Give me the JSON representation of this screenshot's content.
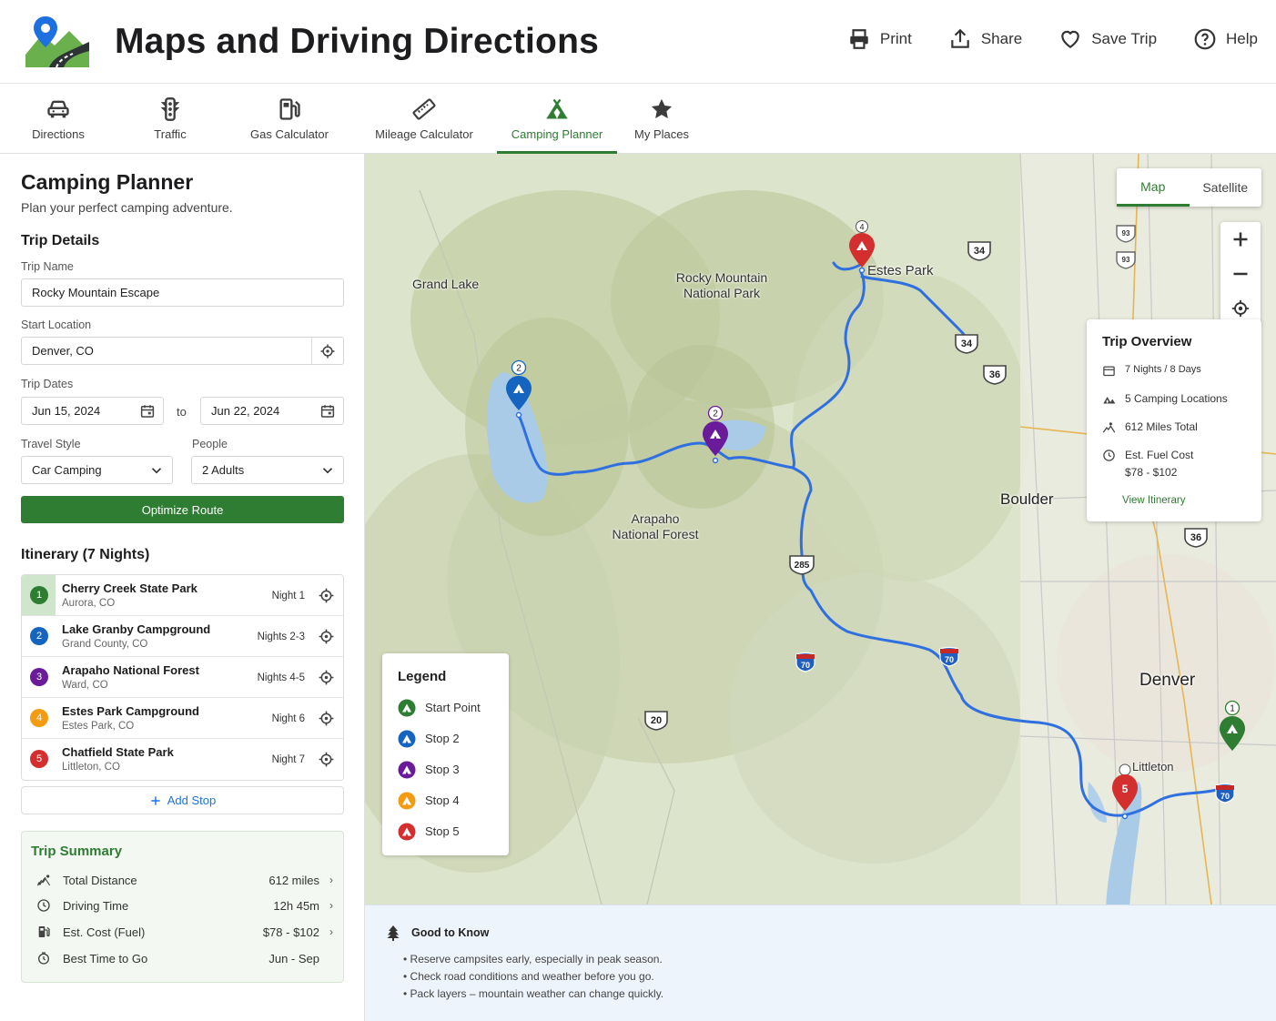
{
  "app": {
    "title": "Maps and Driving Directions"
  },
  "header": {
    "print": "Print",
    "share": "Share",
    "save": "Save Trip",
    "help": "Help"
  },
  "tabs": [
    {
      "label": "Directions",
      "icon": "car-icon"
    },
    {
      "label": "Traffic",
      "icon": "traffic-light-icon"
    },
    {
      "label": "Gas Calculator",
      "icon": "gas-pump-icon"
    },
    {
      "label": "Mileage Calculator",
      "icon": "ruler-icon"
    },
    {
      "label": "Camping Planner",
      "icon": "tent-icon",
      "active": true
    },
    {
      "label": "My Places",
      "icon": "star-icon"
    }
  ],
  "planner": {
    "title": "Camping Planner",
    "subtitle": "Plan your perfect camping adventure.",
    "trip_details_title": "Trip Details",
    "trip_name_label": "Trip Name",
    "trip_name": "Rocky Mountain Escape",
    "start_location_label": "Start Location",
    "start_location": "Denver, CO",
    "trip_dates_label": "Trip Dates",
    "date_start": "Jun 15, 2024",
    "date_to": "to",
    "date_end": "Jun 22, 2024",
    "travel_style_label": "Travel Style",
    "travel_style": "Car Camping",
    "people_label": "People",
    "people": "2 Adults",
    "optimize": "Optimize Route"
  },
  "itinerary": {
    "title": "Itinerary (7 Nights)",
    "add_stop": "Add Stop",
    "items": [
      {
        "num": "1",
        "name": "Cherry Creek State Park",
        "location": "Aurora, CO",
        "nights": "Night 1",
        "color": "#2e7d32"
      },
      {
        "num": "2",
        "name": "Lake Granby Campground",
        "location": "Grand County, CO",
        "nights": "Nights 2-3",
        "color": "#1565c0"
      },
      {
        "num": "3",
        "name": "Arapaho National Forest",
        "location": "Ward, CO",
        "nights": "Nights 4-5",
        "color": "#6a1b9a"
      },
      {
        "num": "4",
        "name": "Estes Park Campground",
        "location": "Estes Park, CO",
        "nights": "Night 6",
        "color": "#f39c12"
      },
      {
        "num": "5",
        "name": "Chatfield State Park",
        "location": "Littleton, CO",
        "nights": "Night 7",
        "color": "#d32f2f"
      }
    ]
  },
  "summary": {
    "title": "Trip Summary",
    "rows": [
      {
        "label": "Total Distance",
        "value": "612 miles",
        "icon": "route-icon"
      },
      {
        "label": "Driving Time",
        "value": "12h 45m",
        "icon": "clock-icon"
      },
      {
        "label": "Est. Cost (Fuel)",
        "value": "$78 - $102",
        "icon": "fuel-icon"
      },
      {
        "label": "Best Time to Go",
        "value": "Jun - Sep",
        "icon": "timer-icon"
      }
    ]
  },
  "map": {
    "toggle_map": "Map",
    "toggle_satellite": "Satellite",
    "labels": {
      "grand_lake": "Grand Lake",
      "rmnp": "Rocky Mountain\nNational Park",
      "estes_park": "Estes Park",
      "boulder": "Boulder",
      "arapaho": "Arapaho\nNational Forest",
      "denver": "Denver",
      "littleton": "Littleton"
    },
    "shields": [
      "34",
      "34",
      "36",
      "36",
      "285",
      "70",
      "70",
      "20",
      "70",
      "93",
      "93"
    ],
    "marker_numbers": [
      "1",
      "2",
      "2",
      "4",
      "5"
    ]
  },
  "overview": {
    "title": "Trip Overview",
    "nights": "7 Nights / 8 Days",
    "locations": "5 Camping Locations",
    "miles": "612 Miles Total",
    "fuel_label": "Est. Fuel Cost",
    "fuel_value": "$78 - $102",
    "link": "View Itinerary"
  },
  "legend": {
    "title": "Legend",
    "items": [
      {
        "label": "Start Point",
        "color": "#2e7d32"
      },
      {
        "label": "Stop 2",
        "color": "#1565c0"
      },
      {
        "label": "Stop 3",
        "color": "#6a1b9a"
      },
      {
        "label": "Stop 4",
        "color": "#f39c12"
      },
      {
        "label": "Stop 5",
        "color": "#d32f2f"
      }
    ]
  },
  "good_to_know": {
    "title": "Good to Know",
    "items": [
      "• Reserve campsites early, especially in peak season.",
      "• Check road conditions and weather before you go.",
      "• Pack layers – mountain weather can change quickly."
    ]
  },
  "colors": {
    "accent": "#2e7d32",
    "route": "#2f6fe0",
    "link": "#1a73e8"
  }
}
